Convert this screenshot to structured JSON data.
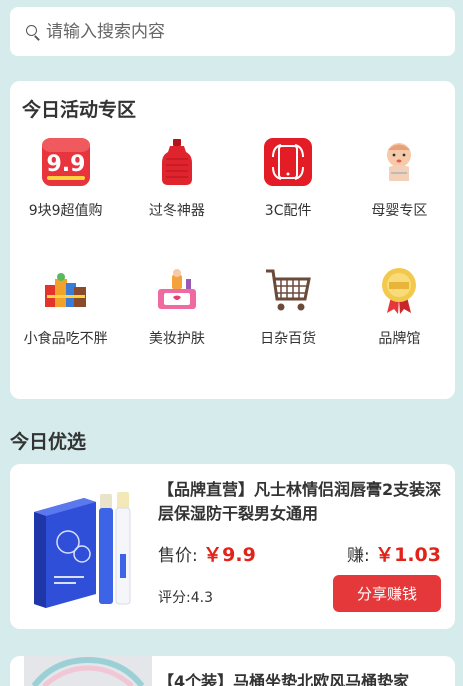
{
  "search": {
    "placeholder": "请输入搜索内容"
  },
  "activity": {
    "title": "今日活动专区",
    "items": [
      {
        "label": "9块9超值购",
        "icon": "nine-nine-badge-icon"
      },
      {
        "label": "过冬神器",
        "icon": "hot-water-bottle-icon"
      },
      {
        "label": "3C配件",
        "icon": "phone-accessory-icon"
      },
      {
        "label": "母婴专区",
        "icon": "baby-icon"
      },
      {
        "label": "小食品吃不胖",
        "icon": "snacks-icon"
      },
      {
        "label": "美妆护肤",
        "icon": "cosmetics-icon"
      },
      {
        "label": "日杂百货",
        "icon": "shopping-cart-icon"
      },
      {
        "label": "品牌馆",
        "icon": "brand-badge-icon"
      }
    ]
  },
  "section_title": "今日优选",
  "products": [
    {
      "title": "【品牌直营】凡士林情侣润唇膏2支装深层保湿防干裂男女通用",
      "price_label": "售价:",
      "price": "￥9.9",
      "earn_label": "赚:",
      "earn": "￥1.03",
      "rating_label": "评分:",
      "rating": "4.3",
      "button": "分享赚钱"
    },
    {
      "title": "【4个装】马桶坐垫北欧风马桶垫家"
    }
  ],
  "colors": {
    "background": "#d6ecec",
    "price": "#e2231a",
    "button": "#e5383b"
  }
}
